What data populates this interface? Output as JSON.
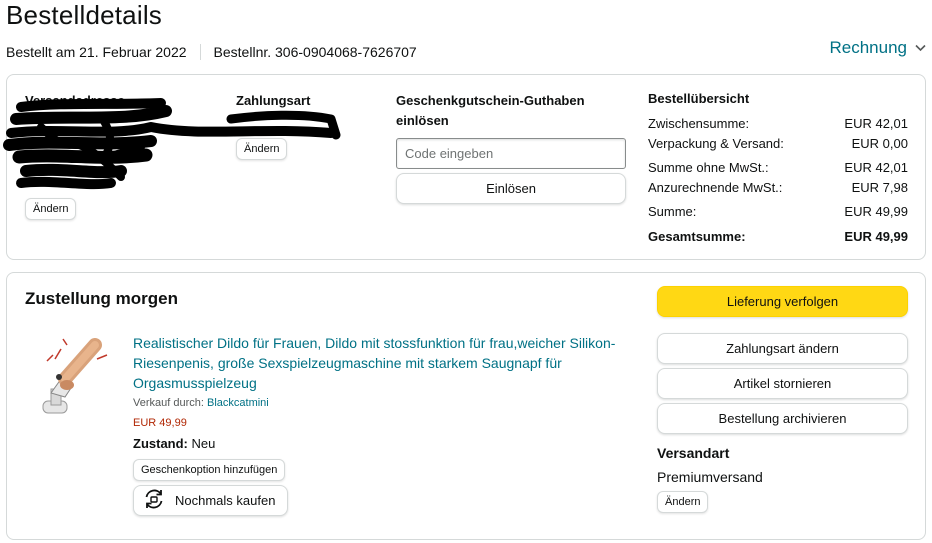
{
  "header": {
    "title": "Bestelldetails",
    "ordered_on": "Bestellt am 21. Februar 2022",
    "order_number": "Bestellnr. 306-0904068-7626707",
    "invoice_label": "Rechnung"
  },
  "address_section": {
    "shipping_label": "Versandadresse",
    "payment_label": "Zahlungsart",
    "change_payment": "Ändern",
    "change_address": "Ändern"
  },
  "gift_card": {
    "title": "Geschenkgutschein-Guthaben einlösen",
    "input_placeholder": "Code eingeben",
    "redeem_label": "Einlösen"
  },
  "summary": {
    "title": "Bestellübersicht",
    "rows": [
      {
        "label": "Zwischensumme:",
        "value": "EUR 42,01"
      },
      {
        "label": "Verpackung & Versand:",
        "value": "EUR 0,00"
      },
      {
        "label": "Summe ohne MwSt.:",
        "value": "EUR 42,01"
      },
      {
        "label": "Anzurechnende MwSt.:",
        "value": "EUR 7,98"
      },
      {
        "label": "Summe:",
        "value": "EUR 49,99"
      }
    ],
    "total": {
      "label": "Gesamtsumme:",
      "value": "EUR 49,99"
    }
  },
  "delivery": {
    "title": "Zustellung morgen",
    "product_title": "Realistischer Dildo für Frauen, Dildo mit stossfunktion für frau,weicher Silikon-Riesenpenis, große Sexspielzeugmaschine mit starkem Saugnapf für Orgasmusspielzeug",
    "seller_prefix": "Verkauf durch:",
    "seller_name": "Blackcatmini",
    "price": "EUR 49,99",
    "condition_label": "Zustand:",
    "condition_value": "Neu",
    "gift_option": "Geschenkoption hinzufügen",
    "buy_again": "Nochmals kaufen"
  },
  "actions": {
    "track": "Lieferung verfolgen",
    "change_payment": "Zahlungsart ändern",
    "cancel": "Artikel stornieren",
    "archive": "Bestellung archivieren",
    "shipping_label": "Versandart",
    "shipping_value": "Premiumversand",
    "change_shipping": "Ändern"
  },
  "colors": {
    "link": "#007185",
    "primary_button": "#ffd814",
    "price": "#b12704",
    "border": "#d5d9d9"
  },
  "icons": {
    "invoice_chevron": "chevron-down-icon",
    "buy_again": "reorder-icon"
  }
}
